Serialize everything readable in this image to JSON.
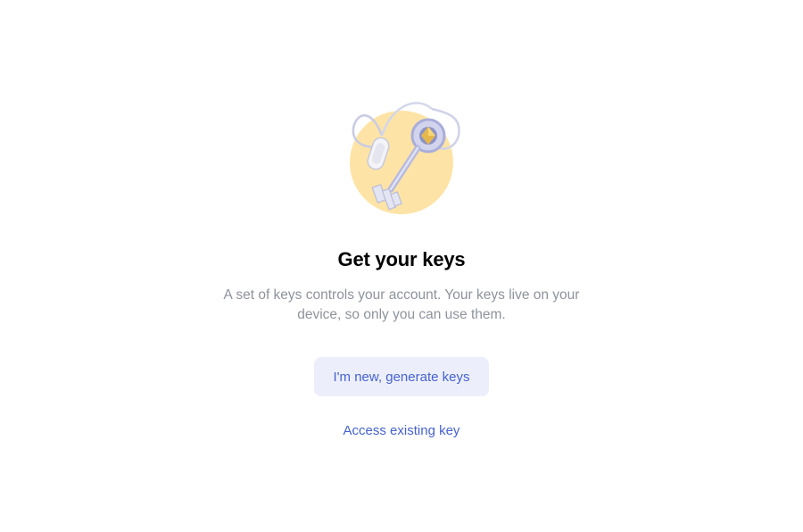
{
  "onboarding": {
    "illustration_icon": "keys-illustration-icon",
    "title": "Get your keys",
    "description": "A set of keys controls your account. Your keys live on your device, so only you can use them.",
    "primary_action_label": "I'm new, generate keys",
    "secondary_action_label": "Access existing key"
  },
  "colors": {
    "accent": "#4662cf",
    "button_bg": "#eceffb",
    "illustration_circle": "#fde4a6",
    "muted_text": "#8e939b"
  }
}
